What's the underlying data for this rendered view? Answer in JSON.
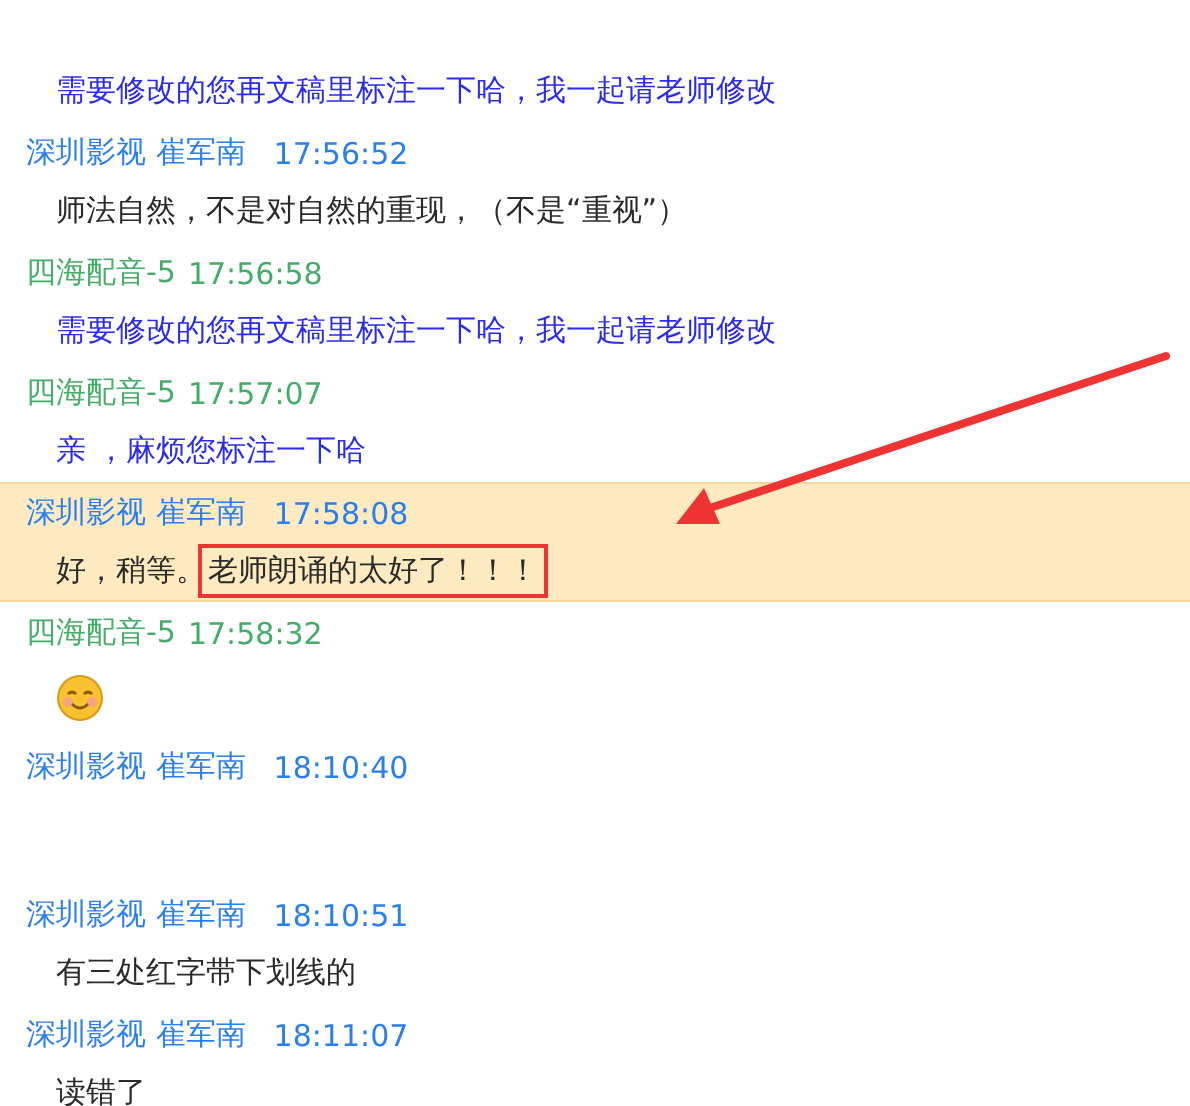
{
  "messages": [
    {
      "kind": "text",
      "selected": false,
      "body": [
        {
          "text": "需要修改的您再文稿里标注一下哈，我一起请老师修改",
          "color": "#2b2bea",
          "boxed": false
        }
      ]
    },
    {
      "kind": "text",
      "sender": {
        "kind": "self",
        "name": "深圳影视 崔军南",
        "time": "17:56:52"
      },
      "selected": false,
      "body": [
        {
          "text": "师法自然，不是对自然的重现，（不是“重视”）",
          "color": "#2a2a2a",
          "boxed": false
        }
      ]
    },
    {
      "kind": "text",
      "sender": {
        "kind": "other",
        "name": "四海配音-5",
        "time": "17:56:58"
      },
      "selected": false,
      "body": [
        {
          "text": "需要修改的您再文稿里标注一下哈，我一起请老师修改",
          "color": "#2b2bea",
          "boxed": false
        }
      ]
    },
    {
      "kind": "text",
      "sender": {
        "kind": "other",
        "name": "四海配音-5",
        "time": "17:57:07"
      },
      "selected": false,
      "body": [
        {
          "text": "亲 ，麻烦您标注一下哈",
          "color": "#2b2bea",
          "boxed": false
        }
      ]
    },
    {
      "kind": "text",
      "sender": {
        "kind": "self",
        "name": "深圳影视 崔军南",
        "time": "17:58:08"
      },
      "selected": true,
      "body": [
        {
          "text": "好，稍等。",
          "color": "#2a2a2a",
          "boxed": false
        },
        {
          "text": "老师朗诵的太好了！！！",
          "color": "#2a2a2a",
          "boxed": true
        }
      ]
    },
    {
      "kind": "emoji",
      "sender": {
        "kind": "other",
        "name": "四海配音-5",
        "time": "17:58:32"
      },
      "selected": false
    },
    {
      "kind": "blank",
      "sender": {
        "kind": "self",
        "name": "深圳影视 崔军南",
        "time": "18:10:40"
      },
      "selected": false
    },
    {
      "kind": "text",
      "sender": {
        "kind": "self",
        "name": "深圳影视 崔军南",
        "time": "18:10:51"
      },
      "selected": false,
      "body": [
        {
          "text": "有三处红字带下划线的",
          "color": "#2a2a2a",
          "boxed": false
        }
      ]
    },
    {
      "kind": "text",
      "sender": {
        "kind": "self",
        "name": "深圳影视 崔军南",
        "time": "18:11:07"
      },
      "selected": false,
      "body": [
        {
          "text": "读错了",
          "color": "#2a2a2a",
          "boxed": false
        }
      ]
    }
  ]
}
